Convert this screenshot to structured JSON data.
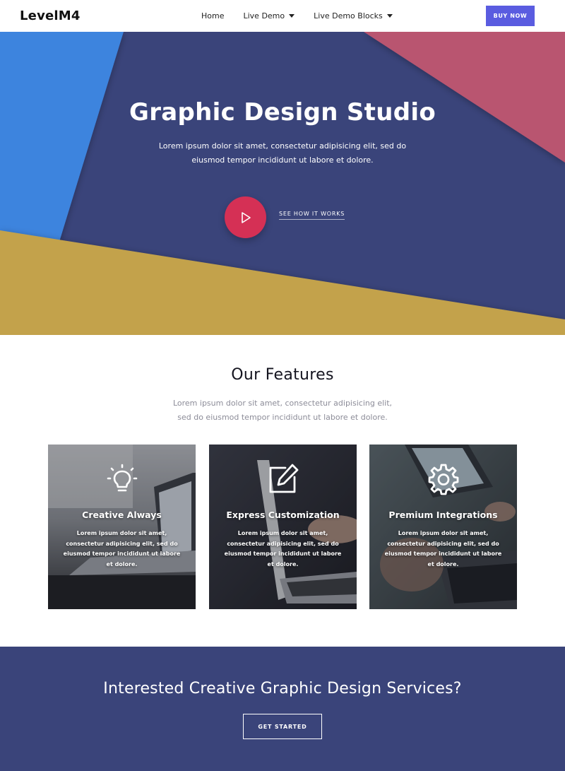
{
  "nav": {
    "brand": "LevelM4",
    "items": [
      {
        "label": "Home",
        "dropdown": false
      },
      {
        "label": "Live Demo",
        "dropdown": true
      },
      {
        "label": "Live Demo Blocks",
        "dropdown": true
      }
    ],
    "buy_label": "BUY NOW",
    "buy_color": "#5a5ce0"
  },
  "hero": {
    "title": "Graphic Design Studio",
    "subtitle": "Lorem ipsum dolor sit amet, consectetur adipisicing elit, sed do eiusmod tempor incididunt ut labore et dolore.",
    "play_icon": "play-icon",
    "link_label": "SEE HOW IT WORKS",
    "colors": {
      "navy": "#3a447a",
      "blue": "#3d84de",
      "pink": "#b95470",
      "gold": "#c3a24c",
      "play": "#d53055"
    }
  },
  "features": {
    "title": "Our Features",
    "subtitle": "Lorem ipsum dolor sit amet, consectetur adipisicing elit, sed do eiusmod tempor incididunt ut labore et dolore.",
    "cards": [
      {
        "icon": "lightbulb-icon",
        "title": "Creative Always",
        "text": "Lorem ipsum dolor sit amet, consectetur adipisicing elit, sed do eiusmod tempor incididunt ut labore et dolore."
      },
      {
        "icon": "edit-icon",
        "title": "Express Customization",
        "text": "Lorem ipsum dolor sit amet, consectetur adipisicing elit, sed do eiusmod tempor incididunt ut labore et dolore."
      },
      {
        "icon": "gear-icon",
        "title": "Premium Integrations",
        "text": "Lorem ipsum dolor sit amet, consectetur adipisicing elit, sed do eiusmod tempor incididunt ut labore et dolore."
      }
    ]
  },
  "cta": {
    "title": "Interested Creative Graphic Design Services?",
    "button_label": "GET STARTED"
  }
}
